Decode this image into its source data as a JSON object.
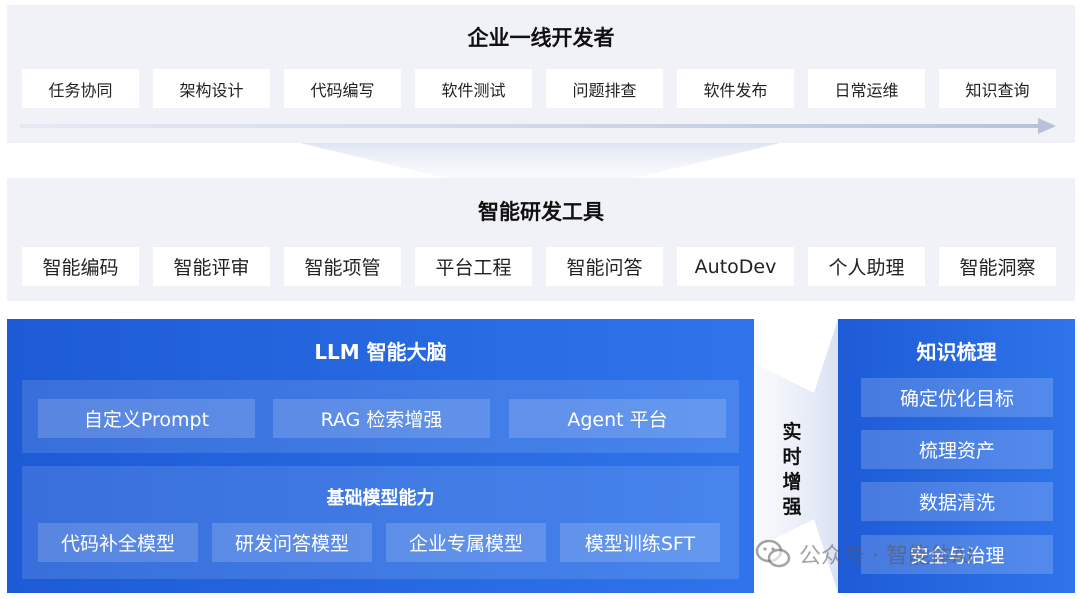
{
  "top": {
    "title": "企业一线开发者",
    "items": [
      "任务协同",
      "架构设计",
      "代码编写",
      "软件测试",
      "问题排查",
      "软件发布",
      "日常运维",
      "知识查询"
    ]
  },
  "tools": {
    "title": "智能研发工具",
    "items": [
      "智能编码",
      "智能评审",
      "智能项管",
      "平台工程",
      "智能问答",
      "AutoDev",
      "个人助理",
      "智能洞察"
    ]
  },
  "brain": {
    "title": "LLM 智能大脑",
    "row1": [
      "自定义Prompt",
      "RAG 检索增强",
      "Agent 平台"
    ],
    "sub_title": "基础模型能力",
    "row2": [
      "代码补全模型",
      "研发问答模型",
      "企业专属模型",
      "模型训练SFT"
    ]
  },
  "realtime": {
    "label": [
      "实",
      "时",
      "增",
      "强"
    ]
  },
  "knowledge": {
    "title": "知识梳理",
    "items": [
      "确定优化目标",
      "梳理资产",
      "数据清洗",
      "安全与治理"
    ]
  },
  "watermark": "公众号 · 智能体AI",
  "colors": {
    "brand_blue": "#1d5bd6",
    "panel_gray": "#f0f2f7"
  }
}
